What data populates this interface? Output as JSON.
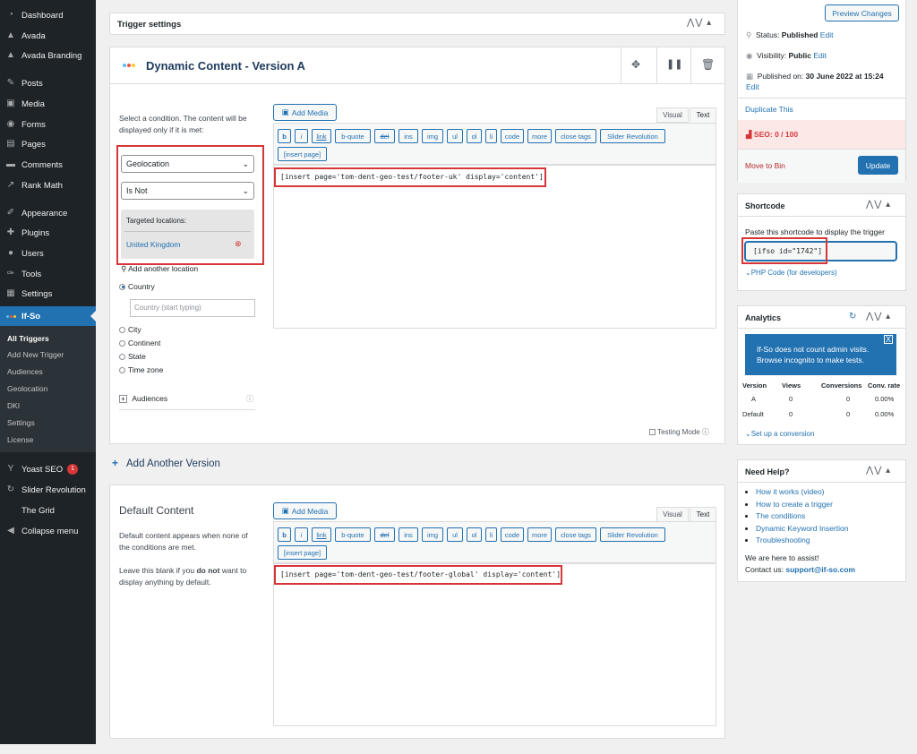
{
  "sidebar": {
    "items": [
      {
        "label": "Dashboard",
        "icon": "dashboard-icon"
      },
      {
        "label": "Avada",
        "icon": "avada-icon"
      },
      {
        "label": "Avada Branding",
        "icon": "avada-icon"
      },
      {
        "label": "Posts",
        "icon": "pin-icon"
      },
      {
        "label": "Media",
        "icon": "media-icon"
      },
      {
        "label": "Forms",
        "icon": "forms-icon"
      },
      {
        "label": "Pages",
        "icon": "pages-icon"
      },
      {
        "label": "Comments",
        "icon": "comments-icon"
      },
      {
        "label": "Rank Math",
        "icon": "rank-math-icon"
      },
      {
        "label": "Appearance",
        "icon": "appearance-icon"
      },
      {
        "label": "Plugins",
        "icon": "plugins-icon"
      },
      {
        "label": "Users",
        "icon": "users-icon"
      },
      {
        "label": "Tools",
        "icon": "tools-icon"
      },
      {
        "label": "Settings",
        "icon": "settings-icon"
      },
      {
        "label": "If-So",
        "icon": "ifso-icon"
      }
    ],
    "submenu": [
      "All Triggers",
      "Add New Trigger",
      "Audiences",
      "Geolocation",
      "DKI",
      "Settings",
      "License"
    ],
    "bottom_items": [
      {
        "label": "Yoast SEO",
        "badge": "1"
      },
      {
        "label": "Slider Revolution"
      },
      {
        "label": "The Grid"
      },
      {
        "label": "Collapse menu"
      }
    ]
  },
  "trigger_settings": {
    "title": "Trigger settings"
  },
  "version_a": {
    "title": "Dynamic Content - Version A",
    "condition_text": "Select a condition. The content will be displayed only if it is met:",
    "condition_select": "Geolocation",
    "operator_select": "Is Not",
    "targeted_label": "Targeted locations:",
    "targeted_value": "United Kingdom",
    "add_location": "Add another location",
    "radios": [
      "Country",
      "City",
      "Continent",
      "State",
      "Time zone"
    ],
    "country_placeholder": "Country (start typing)",
    "audiences_label": "Audiences",
    "testing_mode": "Testing Mode",
    "editor_content": "[insert page='tom-dent-geo-test/footer-uk' display='content']"
  },
  "editor": {
    "add_media": "Add Media",
    "tab_visual": "Visual",
    "tab_text": "Text",
    "quicktags": [
      "b",
      "i",
      "link",
      "b-quote",
      "del",
      "ins",
      "img",
      "ul",
      "ol",
      "li",
      "code",
      "more",
      "close tags",
      "Slider Revolution"
    ],
    "insert_page": "[insert page]"
  },
  "add_version": "Add Another Version",
  "default_content": {
    "title": "Default Content",
    "desc1": "Default content appears when none of the conditions are met.",
    "desc2_pre": "Leave this blank if you ",
    "desc2_bold": "do not",
    "desc2_post": " want to display anything by default.",
    "editor_content": "[insert page='tom-dent-geo-test/footer-global' display='content']"
  },
  "publish": {
    "preview_button": "Preview Changes",
    "status_label": "Status: ",
    "status_value": "Published",
    "edit": "Edit",
    "visibility_label": "Visibility: ",
    "visibility_value": "Public",
    "published_label": "Published on: ",
    "published_value": "30 June 2022 at 15:24",
    "duplicate": "Duplicate This",
    "seo": "SEO: 0 / 100",
    "move_to_bin": "Move to Bin",
    "update_button": "Update"
  },
  "shortcode": {
    "title": "Shortcode",
    "desc": "Paste this shortcode to display the trigger",
    "value": "[ifso id=\"1742\"]",
    "php_link": "PHP Code (for developers)"
  },
  "analytics": {
    "title": "Analytics",
    "notice": "If-So does not count admin visits. Browse incognito to make tests.",
    "columns": [
      "Version",
      "Views",
      "Conversions",
      "Conv. rate"
    ],
    "rows": [
      [
        "A",
        "0",
        "0",
        "0.00%"
      ],
      [
        "Default",
        "0",
        "0",
        "0.00%"
      ]
    ],
    "setup_link": "Set up a conversion"
  },
  "help": {
    "title": "Need Help?",
    "links": [
      "How it works (video)",
      "How to create a trigger",
      "The conditions",
      "Dynamic Keyword Insertion",
      "Troubleshooting"
    ],
    "assist": "We are here to assist!",
    "contact_label": "Contact us: ",
    "contact_email": "support@if-so.com"
  },
  "colors": {
    "accent": "#2271b1",
    "sidebar": "#1d2327",
    "highlight": "#d63638"
  }
}
